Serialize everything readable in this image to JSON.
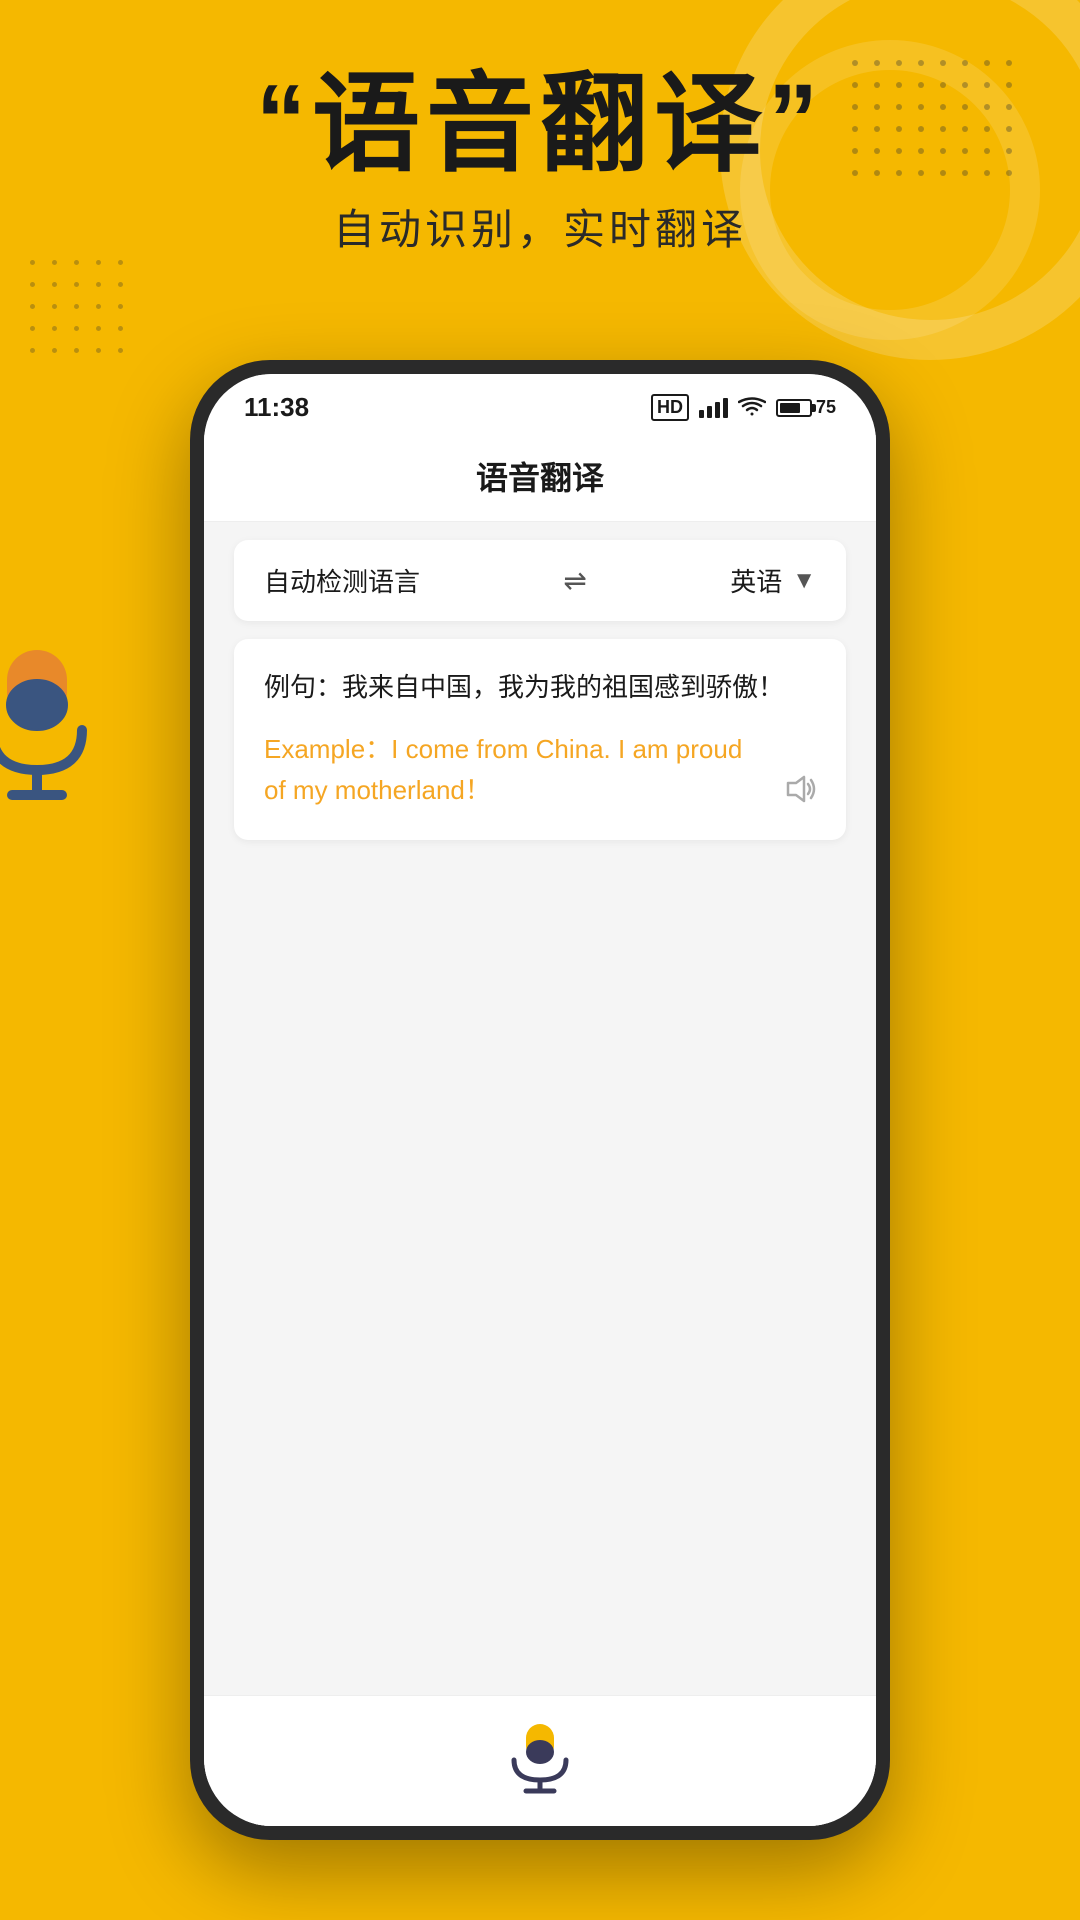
{
  "background": {
    "color": "#F5B800"
  },
  "header": {
    "quote_left": "“",
    "title": "语音翻译",
    "quote_right": "”",
    "subtitle": "自动识别，实时翻译"
  },
  "status_bar": {
    "time": "11:38",
    "hd_label": "HD",
    "battery_level": "75",
    "battery_percent": "75%"
  },
  "app": {
    "title": "语音翻译",
    "source_lang": "自动检测语言",
    "swap_icon": "⇌",
    "target_lang": "英语",
    "source_text": "例句：我来自中国，我为我的祖国感到骄傲！",
    "translated_text_line1": "Example：I come from China. I am proud",
    "translated_text_line2": "of my motherland！",
    "translated_full": "Example：I come from China. I am proud of my motherland！"
  },
  "icons": {
    "signal": "signal-icon",
    "wifi": "wifi-icon",
    "battery": "battery-icon",
    "speaker": "speaker-icon",
    "mic": "mic-icon",
    "chevron": "chevron-down-icon"
  }
}
